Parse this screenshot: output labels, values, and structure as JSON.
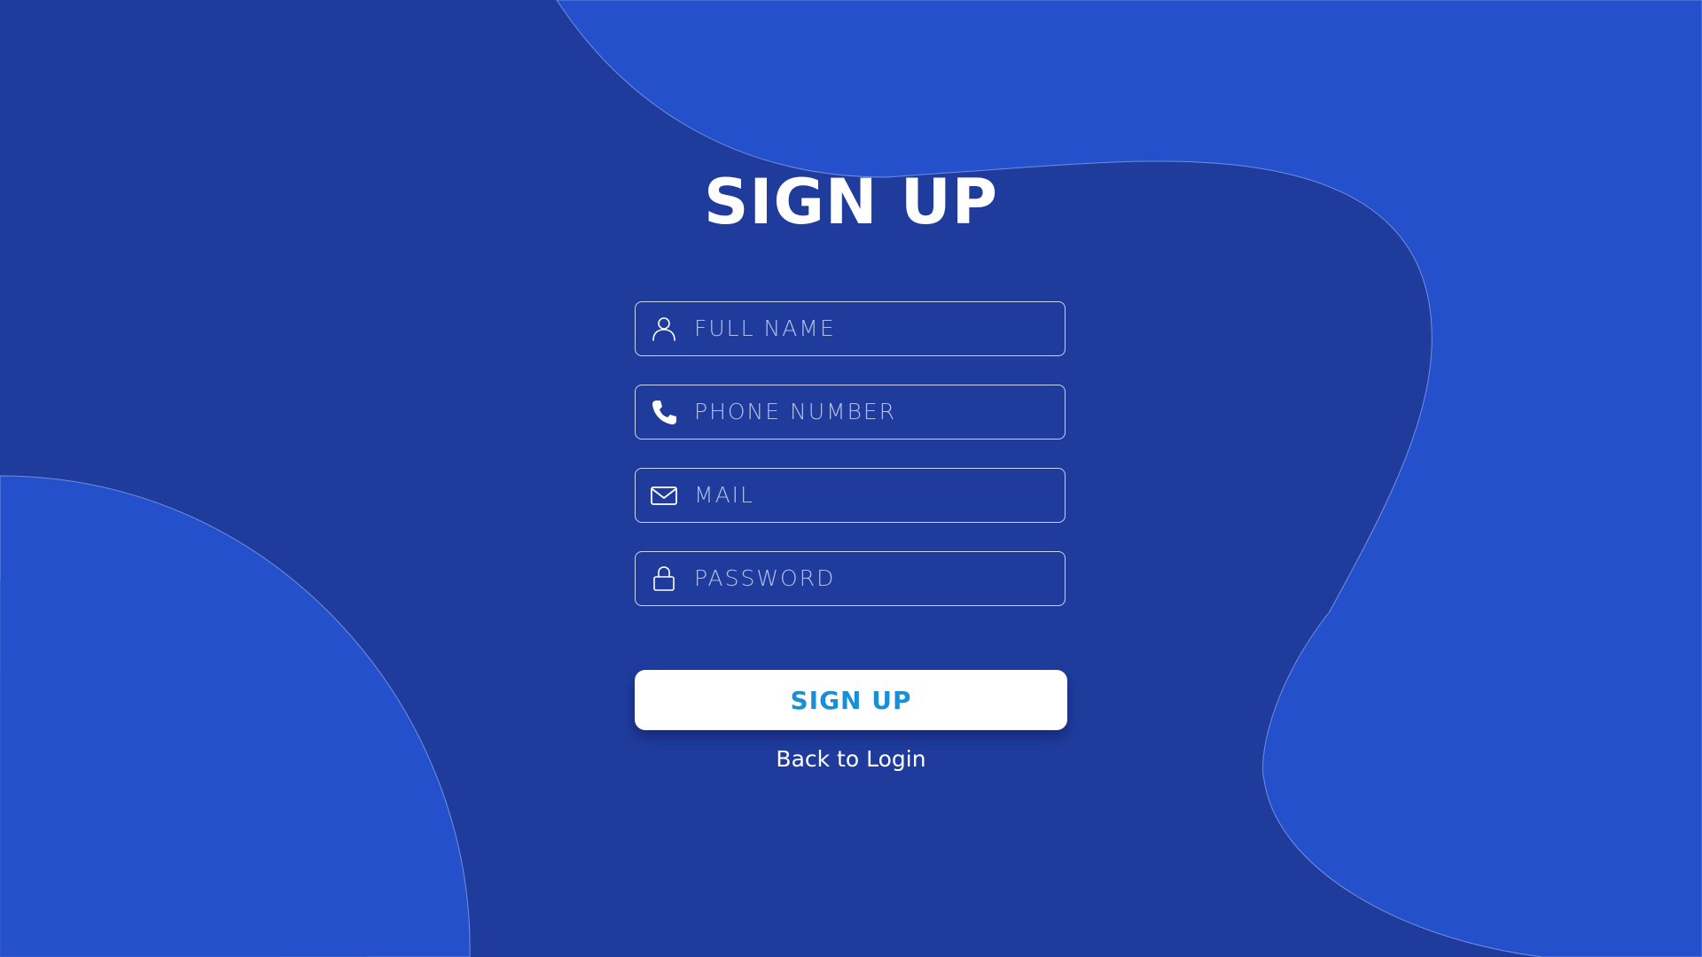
{
  "page": {
    "title": "SIGN UP"
  },
  "form": {
    "full_name_placeholder": "FULL NAME",
    "phone_placeholder": "PHONE NUMBER",
    "mail_placeholder": "MAIL",
    "password_placeholder": "PASSWORD",
    "full_name_icon": "user-icon",
    "phone_icon": "phone-icon",
    "mail_icon": "mail-icon",
    "password_icon": "lock-icon"
  },
  "actions": {
    "submit_label": "SIGN UP",
    "back_link": "Back to Login"
  },
  "colors": {
    "background": "#1f3c9d",
    "blob": "#2550cb",
    "button_bg": "#ffffff",
    "button_text": "#1a8fd6",
    "text": "#ffffff"
  }
}
